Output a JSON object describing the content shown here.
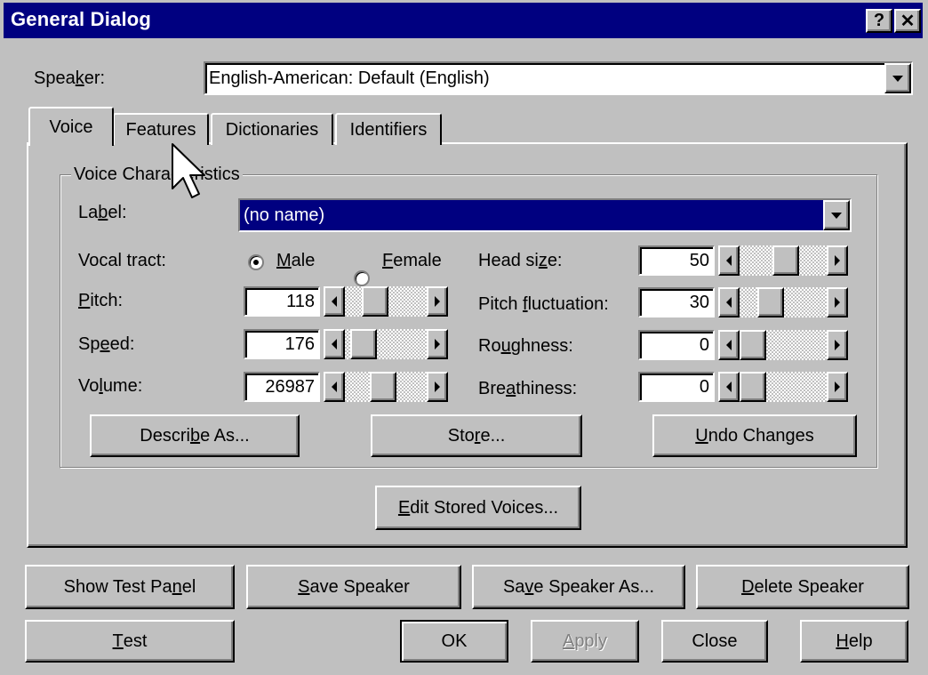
{
  "window": {
    "title": "General Dialog",
    "help_btn": "?",
    "close_btn": "✕"
  },
  "speaker": {
    "label": "Speaker:",
    "value": "English-American: Default (English)"
  },
  "tabs": [
    {
      "label": "Voice"
    },
    {
      "label": "Features"
    },
    {
      "label": "Dictionaries"
    },
    {
      "label": "Identifiers"
    }
  ],
  "group": {
    "title": "Voice Characteristics"
  },
  "label_field": {
    "label": "Label:",
    "value": "(no name)"
  },
  "vocal_tract": {
    "label": "Vocal tract:",
    "male": "Male",
    "female": "Female",
    "selected": "Male"
  },
  "params_left": [
    {
      "label": "Pitch:",
      "value": "118",
      "level": 0.3
    },
    {
      "label": "Speed:",
      "value": "176",
      "level": 0.1
    },
    {
      "label": "Volume:",
      "value": "26987",
      "level": 0.45
    }
  ],
  "params_right": [
    {
      "label": "Head size:",
      "value": "50",
      "level": 0.55
    },
    {
      "label": "Pitch fluctuation:",
      "value": "30",
      "level": 0.3
    },
    {
      "label": "Roughness:",
      "value": "0",
      "level": 0.0
    },
    {
      "label": "Breathiness:",
      "value": "0",
      "level": 0.0
    }
  ],
  "group_buttons": {
    "describe": "Describe As...",
    "store": "Store...",
    "undo": "Undo Changes"
  },
  "edit_stored": "Edit Stored Voices...",
  "row1": {
    "show_test": "Show Test Panel",
    "save": "Save Speaker",
    "save_as": "Save Speaker As...",
    "delete": "Delete Speaker"
  },
  "row2": {
    "test": "Test",
    "ok": "OK",
    "apply": "Apply",
    "close": "Close",
    "help": "Help"
  }
}
